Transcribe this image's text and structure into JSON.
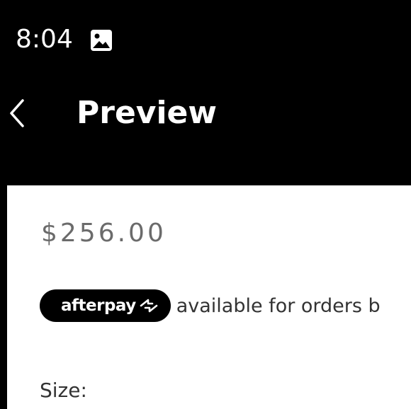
{
  "status_bar": {
    "time": "8:04",
    "notification_icon": "image-icon"
  },
  "header": {
    "back_icon": "chevron-left-icon",
    "title": "Preview"
  },
  "product": {
    "price": "$256.00",
    "afterpay": {
      "badge_label": "afterpay",
      "badge_icon": "afterpay-arrows-icon",
      "note": "available for orders b"
    },
    "size_label": "Size:"
  },
  "colors": {
    "background_dark": "#000000",
    "content_background": "#ffffff",
    "price_text": "#6b6b6b",
    "body_text": "#333333"
  }
}
